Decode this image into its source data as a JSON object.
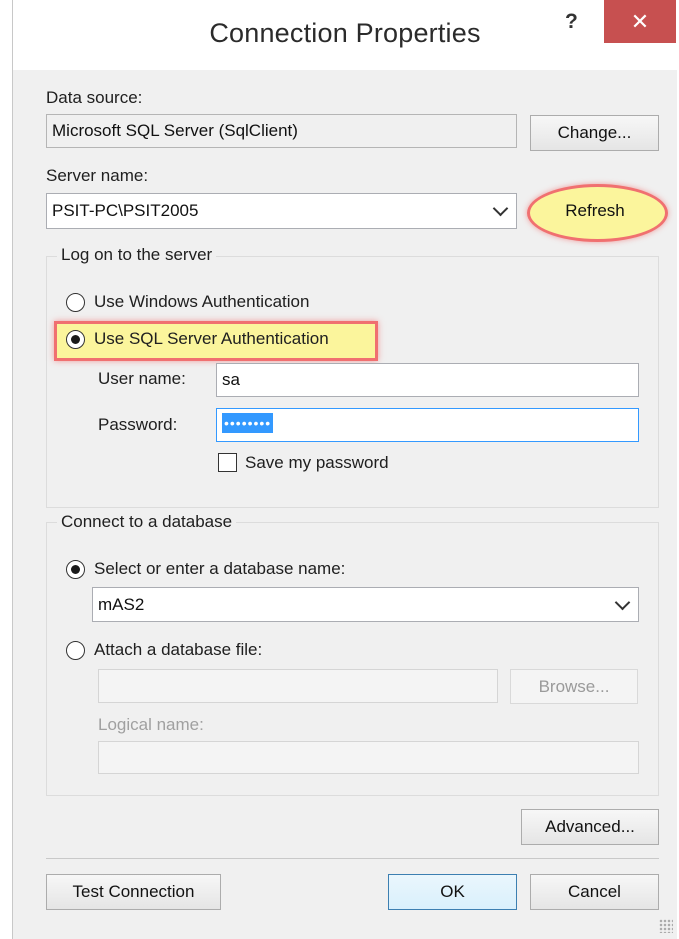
{
  "dialog": {
    "title": "Connection Properties",
    "help_label": "?",
    "close_label": "✕"
  },
  "data_source": {
    "label": "Data source:",
    "value": "Microsoft SQL Server (SqlClient)",
    "change_button": "Change..."
  },
  "server": {
    "label": "Server name:",
    "value": "PSIT-PC\\PSIT2005",
    "refresh_button": "Refresh"
  },
  "logon": {
    "group_title": "Log on to the server",
    "windows_auth": "Use Windows Authentication",
    "sql_auth": "Use SQL Server Authentication",
    "selected": "sql",
    "username_label": "User name:",
    "username_value": "sa",
    "password_label": "Password:",
    "password_value": "••••••••",
    "save_password": "Save my password",
    "save_password_checked": false
  },
  "database": {
    "group_title": "Connect to a database",
    "select_option": "Select or enter a database name:",
    "db_name_value": "mAS2",
    "attach_option": "Attach a database file:",
    "selected": "select",
    "attach_file_value": "",
    "browse_button": "Browse...",
    "logical_name_label": "Logical name:",
    "logical_name_value": ""
  },
  "footer": {
    "advanced_button": "Advanced...",
    "test_connection_button": "Test Connection",
    "ok_button": "OK",
    "cancel_button": "Cancel"
  },
  "colors": {
    "highlight_fill": "#fbf59c",
    "highlight_border": "#f07070",
    "close_button": "#c75050",
    "selection": "#3399ff"
  }
}
